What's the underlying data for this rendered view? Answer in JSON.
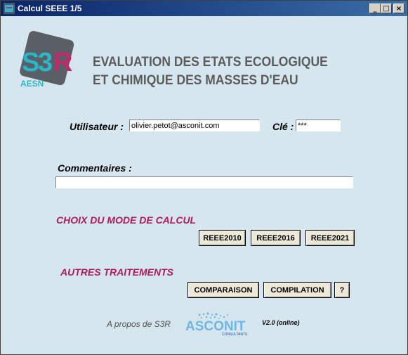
{
  "window": {
    "title": "Calcul SEEE 1/5",
    "min": "_",
    "max": "□",
    "close": "×"
  },
  "logo": {
    "text": "S3R",
    "sub": "AESN"
  },
  "headline": {
    "line1": "EVALUATION DES ETATS ECOLOGIQUE",
    "line2": "ET CHIMIQUE DES MASSES D'EAU"
  },
  "login": {
    "user_label": "Utilisateur :",
    "user_value": "olivier.petot@asconit.com",
    "key_label": "Clé :",
    "key_value": "***"
  },
  "comments": {
    "label": "Commentaires :",
    "value": ""
  },
  "calc_mode": {
    "title": "CHOIX DU MODE DE CALCUL",
    "buttons": [
      "REEE2010",
      "REEE2016",
      "REEE2021"
    ]
  },
  "other": {
    "title": "AUTRES TRAITEMENTS",
    "buttons": [
      "COMPARAISON",
      "COMPILATION",
      "?"
    ]
  },
  "footer": {
    "about": "A propos de S3R",
    "brand": "ASCONIT",
    "brand_sub": "CONSULTANTS",
    "version": "V2.0 (online)"
  }
}
